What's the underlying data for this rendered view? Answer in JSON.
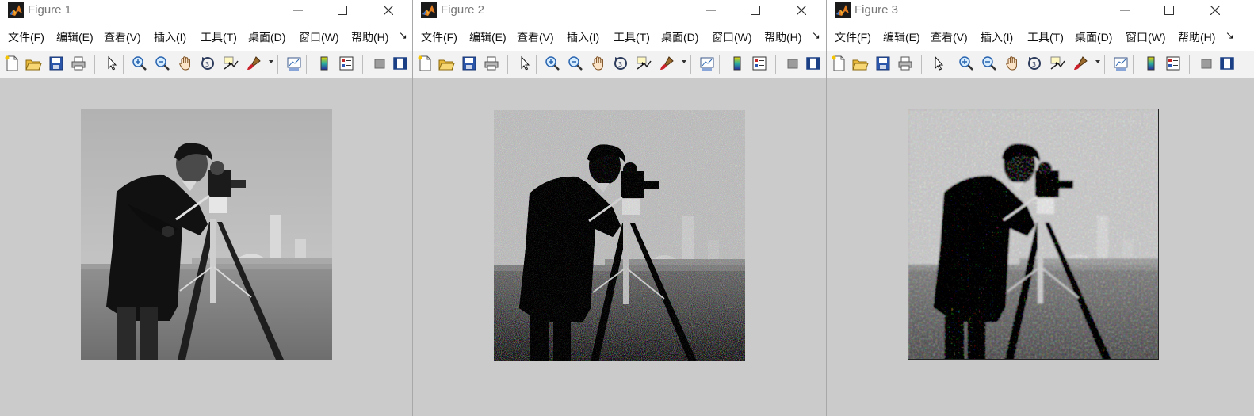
{
  "figures": [
    {
      "title": "Figure 1",
      "image": {
        "name": "cameraman-original",
        "style": "clean"
      }
    },
    {
      "title": "Figure 2",
      "image": {
        "name": "cameraman-noisy",
        "style": "noisy"
      }
    },
    {
      "title": "Figure 3",
      "image": {
        "name": "cameraman-denoised",
        "style": "smoothed"
      }
    }
  ],
  "menu": [
    "文件(F)",
    "编辑(E)",
    "查看(V)",
    "插入(I)",
    "工具(T)",
    "桌面(D)",
    "窗口(W)",
    "帮助(H)"
  ],
  "menu_more": "↘",
  "toolbar_icons": [
    "new-figure-icon",
    "open-file-icon",
    "save-icon",
    "print-icon",
    "edit-plot-icon",
    "zoom-in-icon",
    "zoom-out-icon",
    "pan-icon",
    "rotate-3d-icon",
    "data-cursor-icon",
    "brush-icon",
    "link-plot-icon",
    "colorbar-icon",
    "legend-icon",
    "hide-plot-tools-icon",
    "show-plot-tools-icon"
  ],
  "colors": {
    "background": "#cbcbcb",
    "titlebar": "#ffffff",
    "toolbar": "#f2f2f2",
    "title_text": "#777777"
  }
}
